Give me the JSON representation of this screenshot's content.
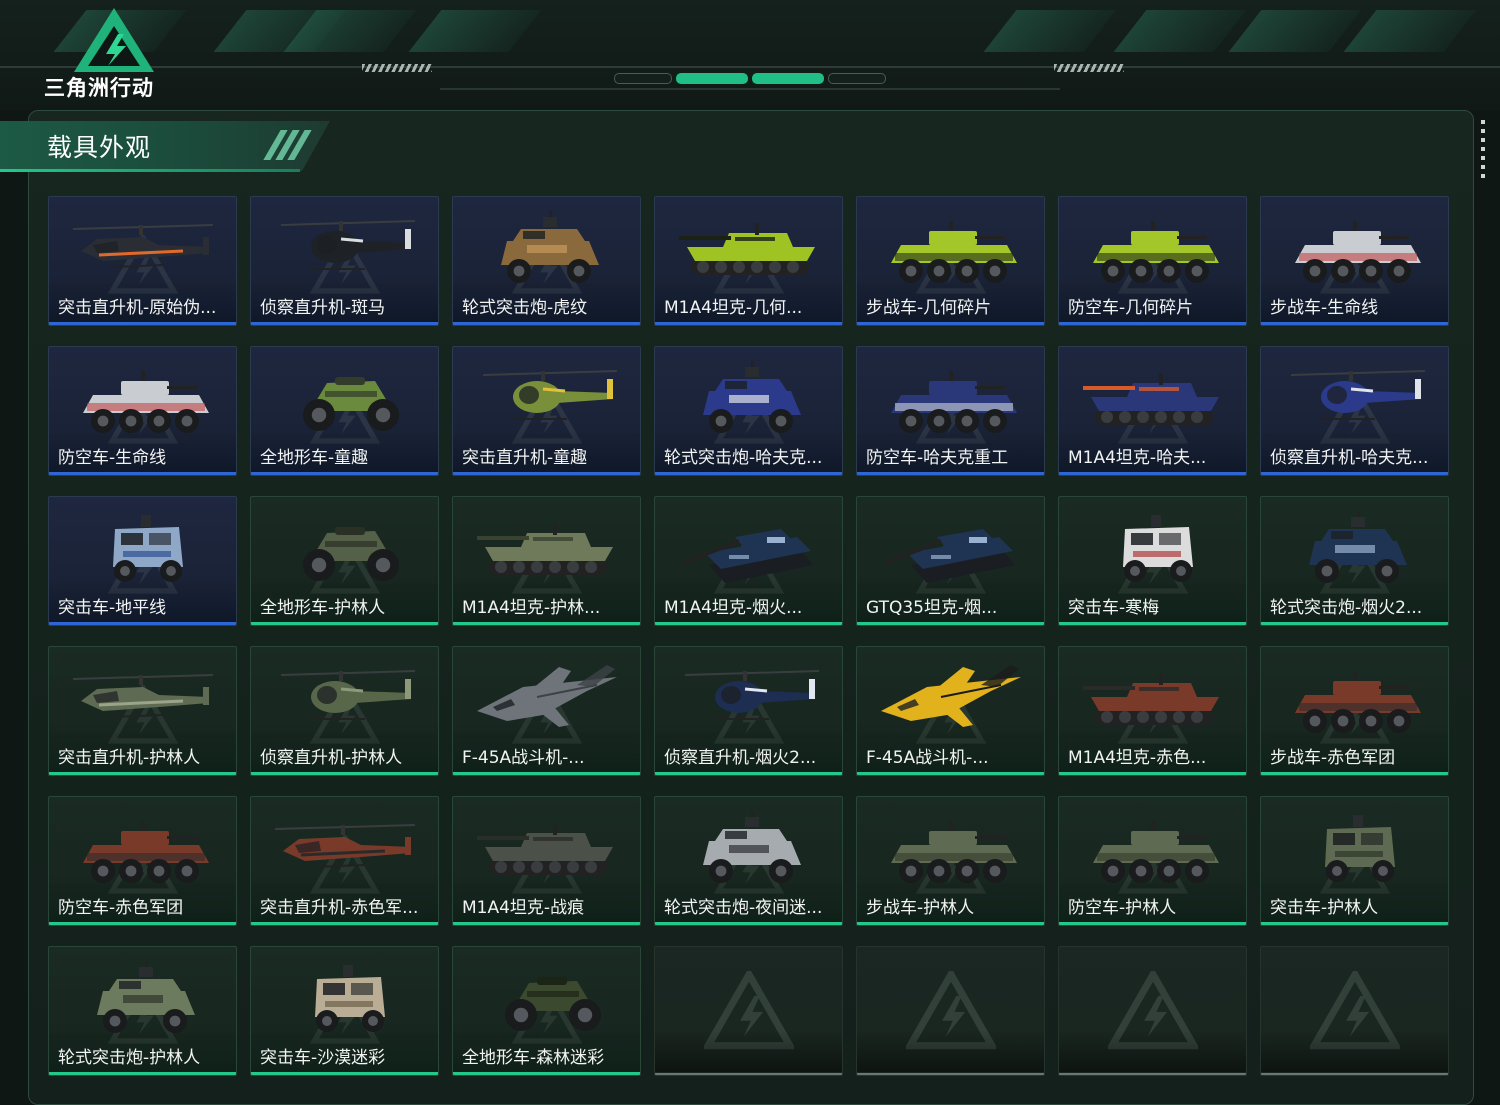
{
  "header": {
    "game_title": "三角洲行动",
    "logo_icon": "delta-lightning-logo",
    "accent_color": "#23c98b"
  },
  "page": {
    "title": "载具外观"
  },
  "rarity_colors": {
    "blue": "#2f66d6",
    "green": "#23c98b",
    "empty": "#8e9a96"
  },
  "items": [
    {
      "label": "突击直升机-原始伪...",
      "type": "heli",
      "rarity": "blue",
      "color": "#2a2d34",
      "accent": "#e06a2b"
    },
    {
      "label": "侦察直升机-斑马",
      "type": "heli-small",
      "rarity": "blue",
      "color": "#1e2226",
      "accent": "#d8dde0"
    },
    {
      "label": "轮式突击炮-虎纹",
      "type": "armored-car",
      "rarity": "blue",
      "color": "#8a6a3d",
      "accent": "#c99a5c"
    },
    {
      "label": "M1A4坦克-几何...",
      "type": "tank",
      "rarity": "blue",
      "color": "#9fc323",
      "accent": "#1b2214"
    },
    {
      "label": "步战车-几何碎片",
      "type": "ifv",
      "rarity": "blue",
      "color": "#a3c728",
      "accent": "#1b2214"
    },
    {
      "label": "防空车-几何碎片",
      "type": "ifv",
      "rarity": "blue",
      "color": "#a3c728",
      "accent": "#1b2214"
    },
    {
      "label": "步战车-生命线",
      "type": "ifv",
      "rarity": "blue",
      "color": "#c9ccd0",
      "accent": "#c33c3c"
    },
    {
      "label": "防空车-生命线",
      "type": "ifv",
      "rarity": "blue",
      "color": "#c9ccd0",
      "accent": "#c33c3c"
    },
    {
      "label": "全地形车-童趣",
      "type": "atv",
      "rarity": "blue",
      "color": "#6a8a3e",
      "accent": "#333b2a"
    },
    {
      "label": "突击直升机-童趣",
      "type": "heli-small",
      "rarity": "blue",
      "color": "#7a8f3a",
      "accent": "#e0c23a"
    },
    {
      "label": "轮式突击炮-哈夫克...",
      "type": "armored-car",
      "rarity": "blue",
      "color": "#2b3a8a",
      "accent": "#dfe4ea"
    },
    {
      "label": "防空车-哈夫克重工",
      "type": "ifv",
      "rarity": "blue",
      "color": "#2a3778",
      "accent": "#dfe4ea"
    },
    {
      "label": "M1A4坦克-哈夫...",
      "type": "tank",
      "rarity": "blue",
      "color": "#2a3778",
      "accent": "#d75a2a"
    },
    {
      "label": "侦察直升机-哈夫克...",
      "type": "heli-small",
      "rarity": "blue",
      "color": "#2b3a8a",
      "accent": "#dfe4ea"
    },
    {
      "label": "突击车-地平线",
      "type": "mrap",
      "rarity": "blue",
      "color": "#8fa8c8",
      "accent": "#2d4f93"
    },
    {
      "label": "全地形车-护林人",
      "type": "atv",
      "rarity": "green",
      "color": "#556049",
      "accent": "#2b3025"
    },
    {
      "label": "M1A4坦克-护林...",
      "type": "tank",
      "rarity": "green",
      "color": "#6e7a5a",
      "accent": "#3a4232"
    },
    {
      "label": "M1A4坦克-烟火...",
      "type": "tank-angle",
      "rarity": "green",
      "color": "#1f3352",
      "accent": "#9ab0d0"
    },
    {
      "label": "GTQ35坦克-烟...",
      "type": "tank-angle",
      "rarity": "green",
      "color": "#1f3352",
      "accent": "#9ab0d0"
    },
    {
      "label": "突击车-寒梅",
      "type": "mrap",
      "rarity": "green",
      "color": "#dcdcdc",
      "accent": "#b03a3a"
    },
    {
      "label": "轮式突击炮-烟火2...",
      "type": "armored-car",
      "rarity": "green",
      "color": "#1f3352",
      "accent": "#9ab0d0"
    },
    {
      "label": "突击直升机-护林人",
      "type": "heli",
      "rarity": "green",
      "color": "#5e6a52",
      "accent": "#9aa489"
    },
    {
      "label": "侦察直升机-护林人",
      "type": "heli-small",
      "rarity": "green",
      "color": "#58664a",
      "accent": "#8d9a7a"
    },
    {
      "label": "F-45A战斗机-...",
      "type": "jet",
      "rarity": "green",
      "color": "#6e747a",
      "accent": "#3d4247"
    },
    {
      "label": "侦察直升机-烟火2...",
      "type": "heli-small",
      "rarity": "green",
      "color": "#1e2d52",
      "accent": "#e1e7f0"
    },
    {
      "label": "F-45A战斗机-...",
      "type": "jet",
      "rarity": "green",
      "color": "#e2b21d",
      "accent": "#1b1b1b"
    },
    {
      "label": "M1A4坦克-赤色...",
      "type": "tank",
      "rarity": "green",
      "color": "#7a3a2a",
      "accent": "#2a2a2a"
    },
    {
      "label": "步战车-赤色军团",
      "type": "ifv",
      "rarity": "green",
      "color": "#7a3a2a",
      "accent": "#2a2a2a"
    },
    {
      "label": "防空车-赤色军团",
      "type": "ifv",
      "rarity": "green",
      "color": "#7a3a2a",
      "accent": "#2a2a2a"
    },
    {
      "label": "突击直升机-赤色军...",
      "type": "heli",
      "rarity": "green",
      "color": "#7a3a2a",
      "accent": "#2a2a2a"
    },
    {
      "label": "M1A4坦克-战痕",
      "type": "tank",
      "rarity": "green",
      "color": "#4b5048",
      "accent": "#2a2e28"
    },
    {
      "label": "轮式突击炮-夜间迷...",
      "type": "armored-car",
      "rarity": "green",
      "color": "#a6abb0",
      "accent": "#2d3136"
    },
    {
      "label": "步战车-护林人",
      "type": "ifv",
      "rarity": "green",
      "color": "#5e6a52",
      "accent": "#2f3628"
    },
    {
      "label": "防空车-护林人",
      "type": "ifv",
      "rarity": "green",
      "color": "#5e6a52",
      "accent": "#2f3628"
    },
    {
      "label": "突击车-护林人",
      "type": "mrap",
      "rarity": "green",
      "color": "#5e6a52",
      "accent": "#2f3628"
    },
    {
      "label": "轮式突击炮-护林人",
      "type": "armored-car",
      "rarity": "green",
      "color": "#6c7a5e",
      "accent": "#2f3628"
    },
    {
      "label": "突击车-沙漠迷彩",
      "type": "mrap",
      "rarity": "green",
      "color": "#b9ad95",
      "accent": "#6e5f48"
    },
    {
      "label": "全地形车-森林迷彩",
      "type": "atv",
      "rarity": "green",
      "color": "#3b4a2e",
      "accent": "#1c2416"
    },
    {
      "label": "",
      "type": "empty",
      "rarity": "empty"
    },
    {
      "label": "",
      "type": "empty",
      "rarity": "empty"
    },
    {
      "label": "",
      "type": "empty",
      "rarity": "empty"
    },
    {
      "label": "",
      "type": "empty",
      "rarity": "empty"
    }
  ]
}
